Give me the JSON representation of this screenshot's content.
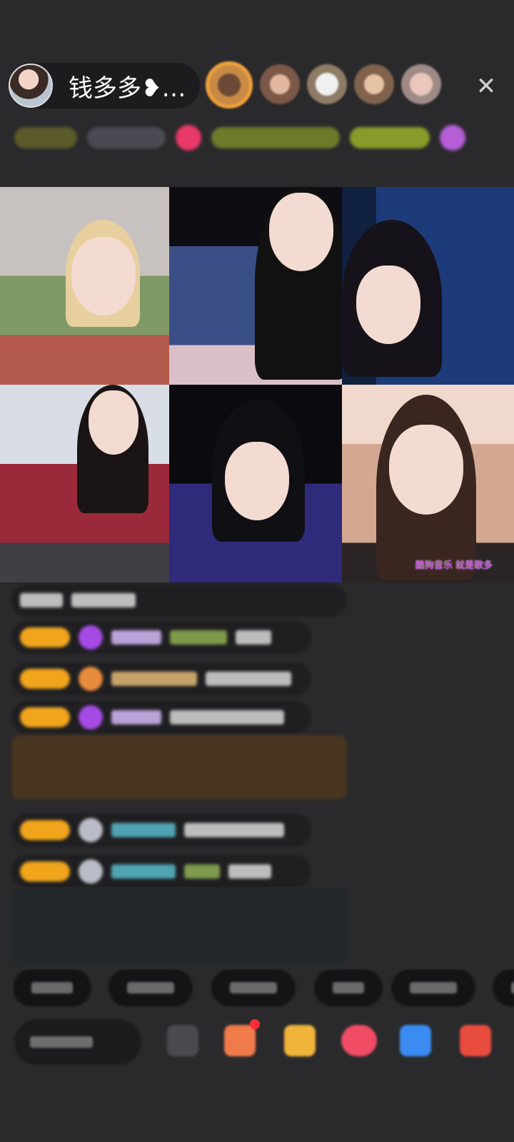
{
  "header": {
    "host_name": "钱多多❥…",
    "close_symbol": "✕"
  },
  "video_grid": {
    "overlay_text": "酷狗音乐 就是歌多"
  }
}
